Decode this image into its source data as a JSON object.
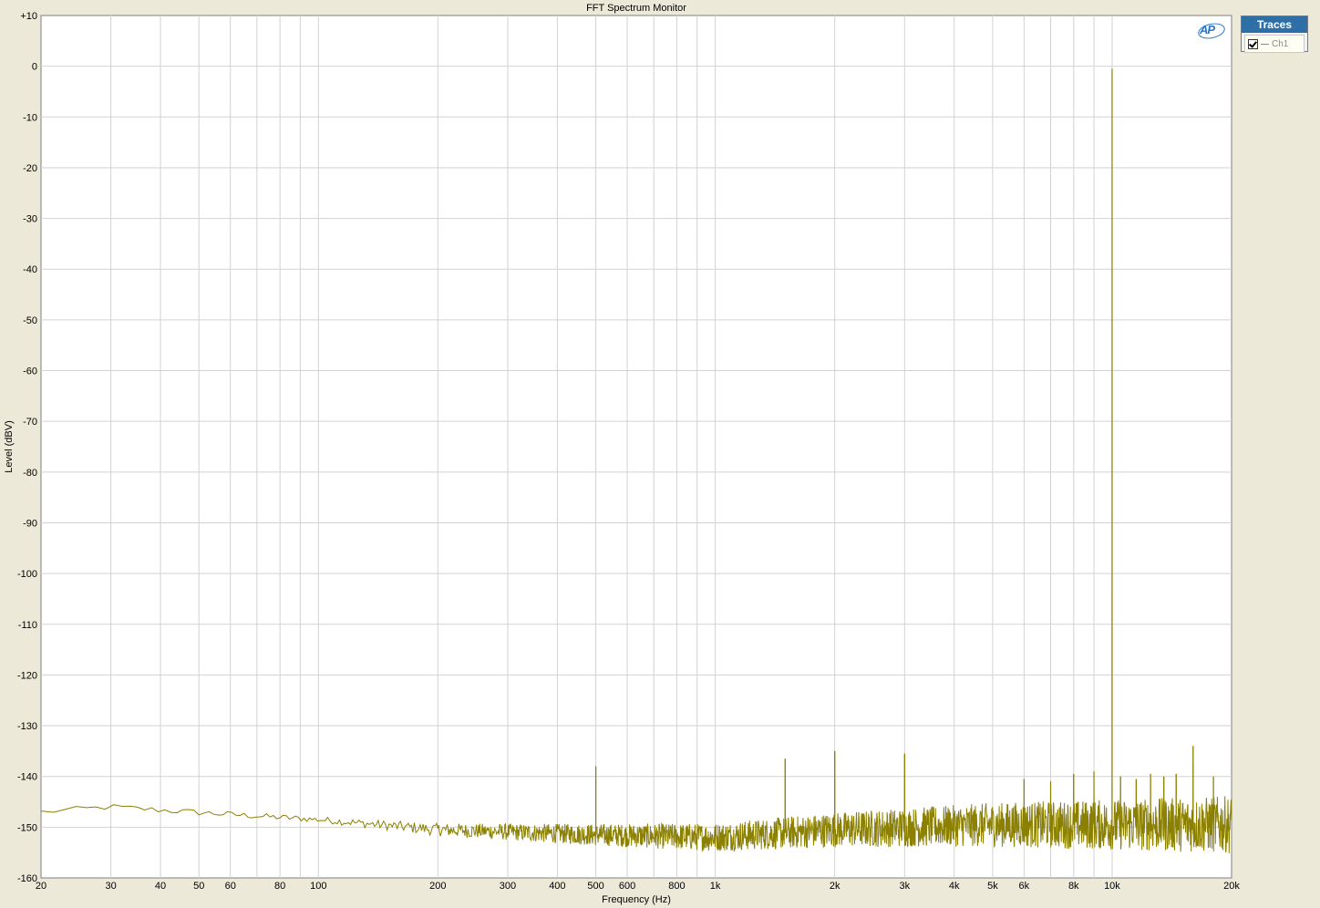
{
  "chart_data": {
    "type": "line",
    "title": "FFT Spectrum Monitor",
    "xlabel": "Frequency (Hz)",
    "ylabel": "Level (dBV)",
    "xscale": "log",
    "xlim": [
      20,
      20000
    ],
    "ylim": [
      -160,
      10
    ],
    "grid": true,
    "legend_placement": "top-right",
    "y_ticks": [
      "+10",
      "0",
      "-10",
      "-20",
      "-30",
      "-40",
      "-50",
      "-60",
      "-70",
      "-80",
      "-90",
      "-100",
      "-110",
      "-120",
      "-130",
      "-140",
      "-150",
      "-160"
    ],
    "x_ticks": [
      {
        "v": 20,
        "label": "20"
      },
      {
        "v": 30,
        "label": "30"
      },
      {
        "v": 40,
        "label": "40"
      },
      {
        "v": 50,
        "label": "50"
      },
      {
        "v": 60,
        "label": "60"
      },
      {
        "v": 80,
        "label": "80"
      },
      {
        "v": 100,
        "label": "100"
      },
      {
        "v": 200,
        "label": "200"
      },
      {
        "v": 300,
        "label": "300"
      },
      {
        "v": 400,
        "label": "400"
      },
      {
        "v": 500,
        "label": "500"
      },
      {
        "v": 600,
        "label": "600"
      },
      {
        "v": 800,
        "label": "800"
      },
      {
        "v": 1000,
        "label": "1k"
      },
      {
        "v": 2000,
        "label": "2k"
      },
      {
        "v": 3000,
        "label": "3k"
      },
      {
        "v": 4000,
        "label": "4k"
      },
      {
        "v": 5000,
        "label": "5k"
      },
      {
        "v": 6000,
        "label": "6k"
      },
      {
        "v": 8000,
        "label": "8k"
      },
      {
        "v": 10000,
        "label": "10k"
      },
      {
        "v": 20000,
        "label": "20k"
      }
    ],
    "series": [
      {
        "name": "Ch1",
        "color": "#8b8000",
        "noise_floor": [
          [
            20,
            -147
          ],
          [
            30,
            -146
          ],
          [
            60,
            -147.5
          ],
          [
            100,
            -148.5
          ],
          [
            200,
            -150.5
          ],
          [
            500,
            -151.5
          ],
          [
            1000,
            -152
          ],
          [
            2000,
            -150.5
          ],
          [
            5000,
            -149.5
          ],
          [
            10000,
            -149.5
          ],
          [
            20000,
            -149.5
          ]
        ],
        "peaks": [
          {
            "f": 500,
            "db": -138
          },
          {
            "f": 1500,
            "db": -136.5
          },
          {
            "f": 2000,
            "db": -135
          },
          {
            "f": 3000,
            "db": -135.5
          },
          {
            "f": 6000,
            "db": -140.5
          },
          {
            "f": 7000,
            "db": -141
          },
          {
            "f": 8000,
            "db": -139.5
          },
          {
            "f": 9000,
            "db": -139
          },
          {
            "f": 10000,
            "db": -0.5
          },
          {
            "f": 10500,
            "db": -140
          },
          {
            "f": 11500,
            "db": -140.5
          },
          {
            "f": 12500,
            "db": -139.5
          },
          {
            "f": 13500,
            "db": -140
          },
          {
            "f": 14500,
            "db": -139.5
          },
          {
            "f": 16000,
            "db": -134
          },
          {
            "f": 18000,
            "db": -140
          }
        ]
      }
    ]
  },
  "legend": {
    "header": "Traces",
    "items": [
      {
        "label": "Ch1",
        "checked": true
      }
    ]
  },
  "logo": {
    "text": "AP"
  }
}
